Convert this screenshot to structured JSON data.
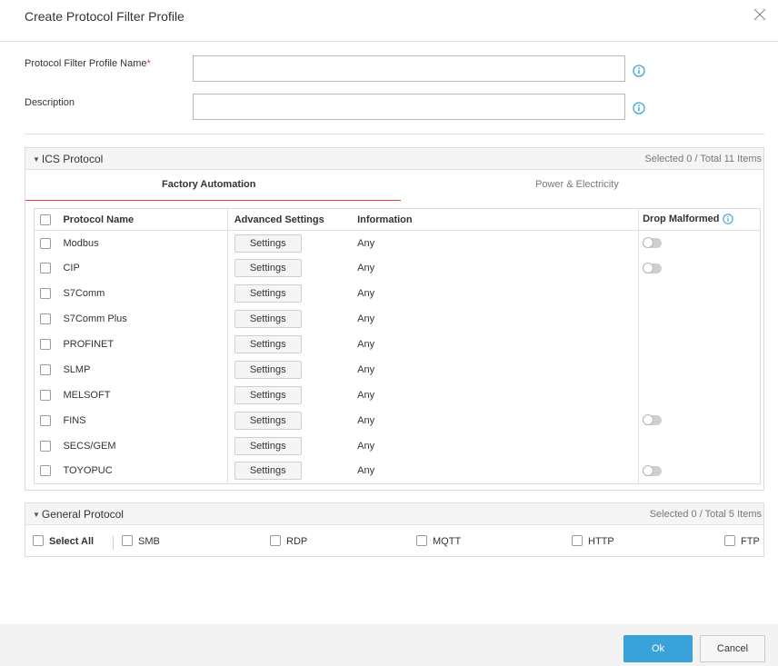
{
  "dialog": {
    "title": "Create Protocol Filter Profile",
    "close_icon": "close-icon"
  },
  "form": {
    "name_label": "Protocol Filter Profile Name",
    "required_mark": "*",
    "name_value": "",
    "description_label": "Description",
    "description_value": "",
    "info_icon": "info-circle-icon"
  },
  "ics": {
    "title": "ICS Protocol",
    "count": "Selected 0 / Total 11 Items",
    "tabs": [
      {
        "label": "Factory Automation",
        "active": true
      },
      {
        "label": "Power & Electricity",
        "active": false
      }
    ],
    "columns": {
      "name": "Protocol Name",
      "advanced": "Advanced Settings",
      "information": "Information",
      "drop": "Drop Malformed"
    },
    "settings_label": "Settings",
    "rows": [
      {
        "name": "Modbus",
        "info": "Any",
        "drop_toggle": true
      },
      {
        "name": "CIP",
        "info": "Any",
        "drop_toggle": true
      },
      {
        "name": "S7Comm",
        "info": "Any",
        "drop_toggle": false
      },
      {
        "name": "S7Comm Plus",
        "info": "Any",
        "drop_toggle": false
      },
      {
        "name": "PROFINET",
        "info": "Any",
        "drop_toggle": false
      },
      {
        "name": "SLMP",
        "info": "Any",
        "drop_toggle": false
      },
      {
        "name": "MELSOFT",
        "info": "Any",
        "drop_toggle": false
      },
      {
        "name": "FINS",
        "info": "Any",
        "drop_toggle": true
      },
      {
        "name": "SECS/GEM",
        "info": "Any",
        "drop_toggle": false
      },
      {
        "name": "TOYOPUC",
        "info": "Any",
        "drop_toggle": true
      }
    ]
  },
  "general": {
    "title": "General Protocol",
    "count": "Selected 0 / Total 5 Items",
    "select_all": "Select All",
    "items": [
      "SMB",
      "RDP",
      "MQTT",
      "HTTP",
      "FTP"
    ]
  },
  "footer": {
    "ok_label": "Ok",
    "cancel_label": "Cancel"
  },
  "colors": {
    "accent_blue": "#39a2db",
    "required_red": "#e0413a",
    "tab_underline": "#e0413a"
  }
}
